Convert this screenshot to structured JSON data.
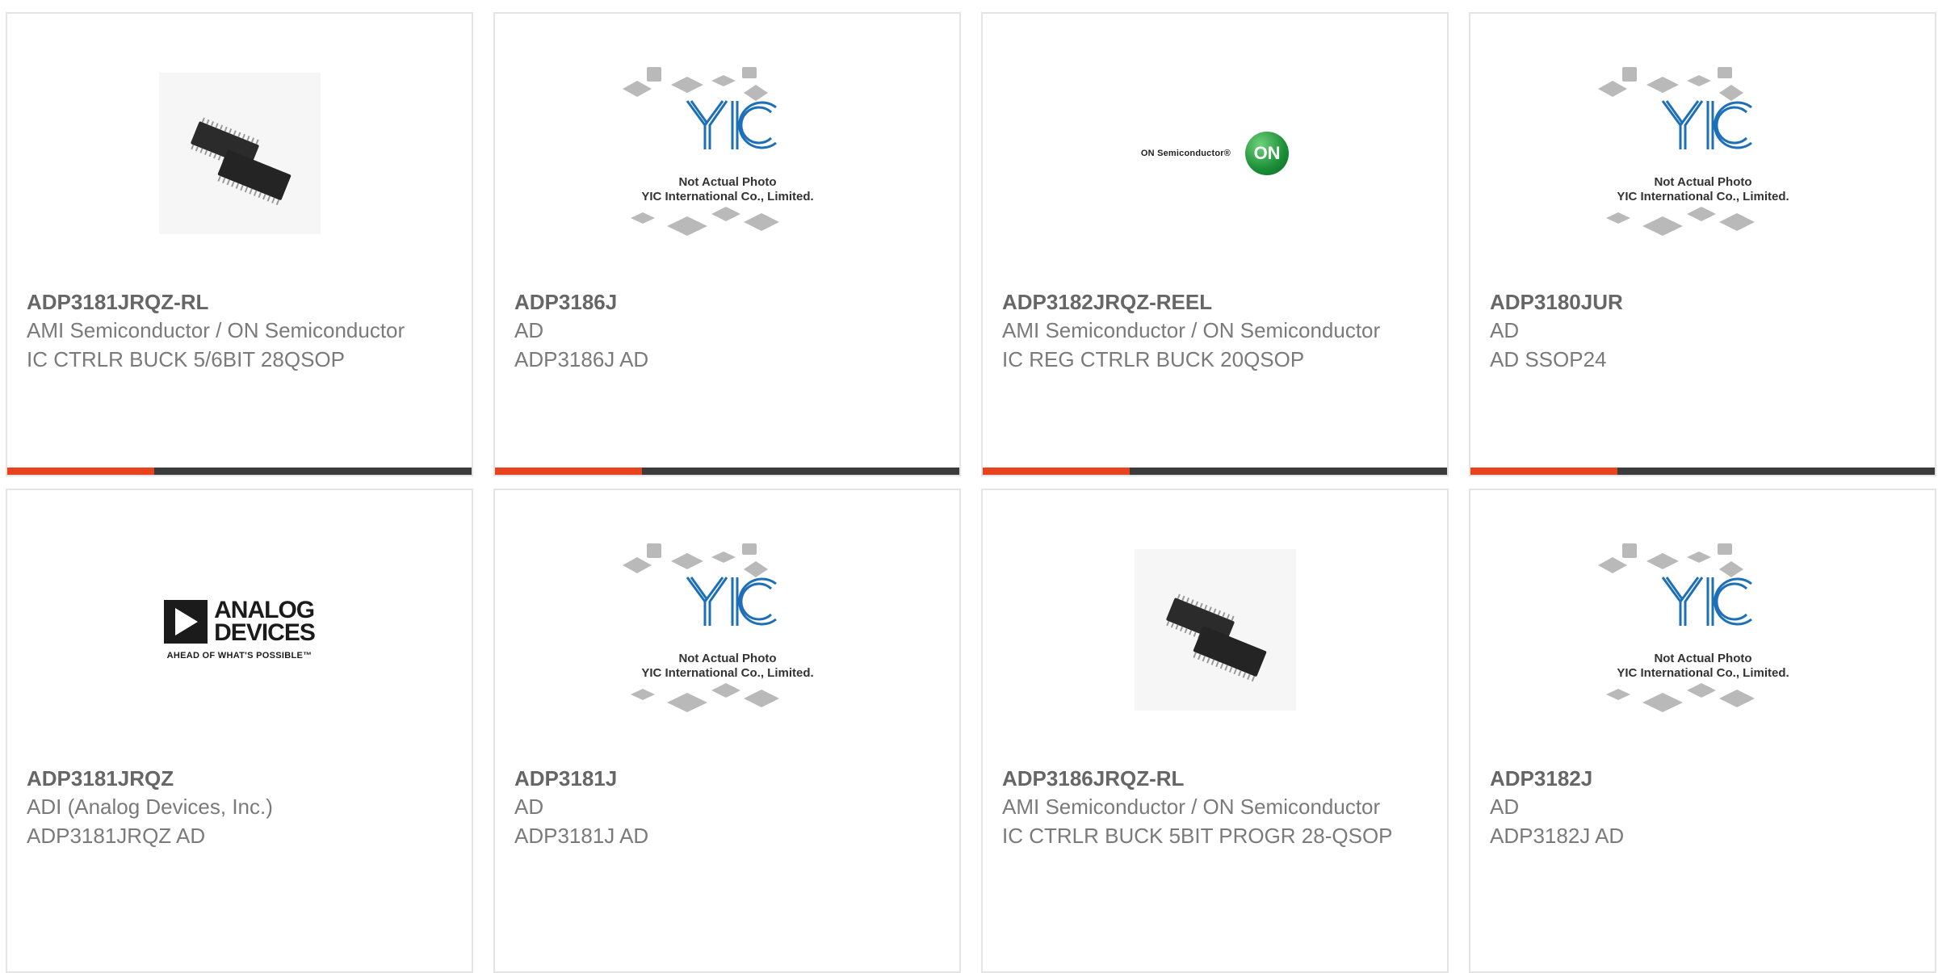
{
  "products": [
    {
      "part": "ADP3181JRQZ-RL",
      "maker": "AMI Semiconductor / ON Semiconductor",
      "desc": "IC CTRLR BUCK 5/6BIT 28QSOP",
      "image": "chip-photo",
      "bar": true
    },
    {
      "part": "ADP3186J",
      "maker": "AD",
      "desc": "ADP3186J AD",
      "image": "yic-placeholder",
      "bar": true
    },
    {
      "part": "ADP3182JRQZ-REEL",
      "maker": "AMI Semiconductor / ON Semiconductor",
      "desc": "IC REG CTRLR BUCK 20QSOP",
      "image": "on-semi-logo",
      "bar": true
    },
    {
      "part": "ADP3180JUR",
      "maker": "AD",
      "desc": "AD SSOP24",
      "image": "yic-placeholder",
      "bar": true
    },
    {
      "part": "ADP3181JRQZ",
      "maker": "ADI (Analog Devices, Inc.)",
      "desc": "ADP3181JRQZ AD",
      "image": "analog-devices-logo",
      "bar": false
    },
    {
      "part": "ADP3181J",
      "maker": "AD",
      "desc": "ADP3181J AD",
      "image": "yic-placeholder",
      "bar": false
    },
    {
      "part": "ADP3186JRQZ-RL",
      "maker": "AMI Semiconductor / ON Semiconductor",
      "desc": "IC CTRLR BUCK 5BIT PROGR 28-QSOP",
      "image": "chip-photo",
      "bar": false
    },
    {
      "part": "ADP3182J",
      "maker": "AD",
      "desc": "ADP3182J AD",
      "image": "yic-placeholder",
      "bar": false
    }
  ],
  "yic": {
    "line1": "Not Actual Photo",
    "line2": "YIC International Co., Limited.",
    "logo_text": "YIC"
  },
  "on_semi": {
    "text": "ON Semiconductor®",
    "mark": "ON"
  },
  "adi": {
    "word1": "ANALOG",
    "word2": "DEVICES",
    "tagline": "AHEAD OF WHAT'S POSSIBLE™"
  },
  "colors": {
    "accent": "#e8431d",
    "bar": "#3b3b3b",
    "border": "#e4e4e4",
    "text": "#666666",
    "yic_blue": "#1d6fb8",
    "on_green": "#1a8d36"
  }
}
